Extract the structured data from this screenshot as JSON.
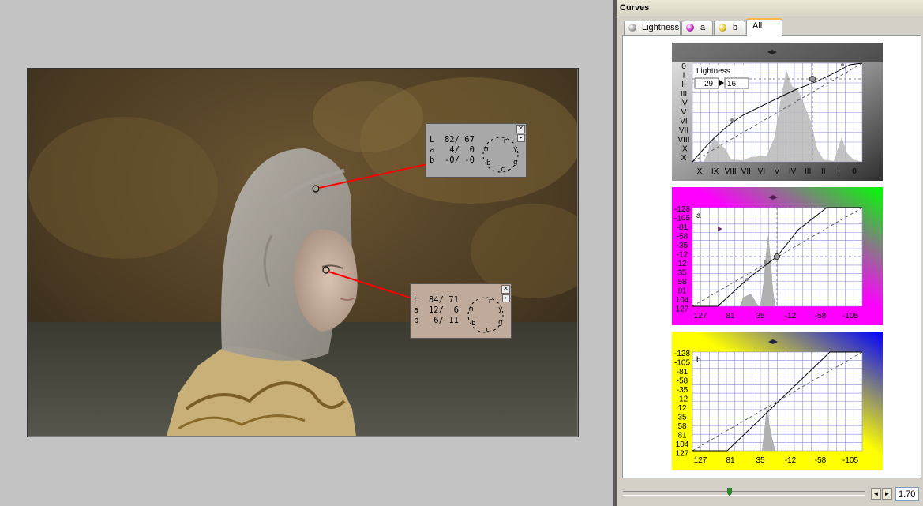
{
  "panel": {
    "title": "Curves",
    "tabs": [
      {
        "label": "Lightness",
        "icon": "lightness-sphere-icon"
      },
      {
        "label": "a",
        "icon": "a-channel-sphere-icon"
      },
      {
        "label": "b",
        "icon": "b-channel-sphere-icon"
      },
      {
        "label": "All",
        "active": true
      }
    ]
  },
  "probes": [
    {
      "rows": [
        "L  82/ 67",
        "a   4/  0",
        "b  -0/ -0"
      ],
      "wheel": [
        "r",
        "y",
        "g",
        "c",
        "b",
        "m"
      ],
      "color": "#a8a8a8"
    },
    {
      "rows": [
        "L  84/ 71",
        "a  12/  6",
        "b   6/ 11"
      ],
      "wheel": [
        "r",
        "y",
        "g",
        "c",
        "b",
        "m"
      ],
      "color": "#c0aa9c"
    }
  ],
  "curves": {
    "lightness": {
      "label": "Lightness",
      "input_value": "29",
      "output_value": "16",
      "y_ticks": [
        "0",
        "I",
        "II",
        "III",
        "IV",
        "V",
        "VI",
        "VII",
        "VIII",
        "IX",
        "X"
      ],
      "x_ticks": [
        "X",
        "IX",
        "VIII",
        "VII",
        "VI",
        "V",
        "IV",
        "III",
        "II",
        "I",
        "0"
      ]
    },
    "a": {
      "label": "a",
      "y_ticks": [
        "-128",
        "-105",
        "-81",
        "-58",
        "-35",
        "-12",
        "12",
        "35",
        "58",
        "81",
        "104",
        "127"
      ],
      "x_ticks": [
        "127",
        "81",
        "35",
        "-12",
        "-58",
        "-105"
      ]
    },
    "b": {
      "label": "b",
      "y_ticks": [
        "-128",
        "-105",
        "-81",
        "-58",
        "-35",
        "-12",
        "12",
        "35",
        "58",
        "81",
        "104",
        "127"
      ],
      "x_ticks": [
        "127",
        "81",
        "35",
        "-12",
        "-58",
        "-105"
      ]
    }
  },
  "zoom": {
    "value": "1.70",
    "left_arrow": "◄",
    "right_arrow": "►"
  },
  "colors": {
    "accent_tab": "#f9b94a",
    "probe_line": "#ff0000",
    "magenta": "#ff00ff",
    "green": "#00ff00",
    "yellow": "#ffff00",
    "blue": "#0000ff"
  }
}
